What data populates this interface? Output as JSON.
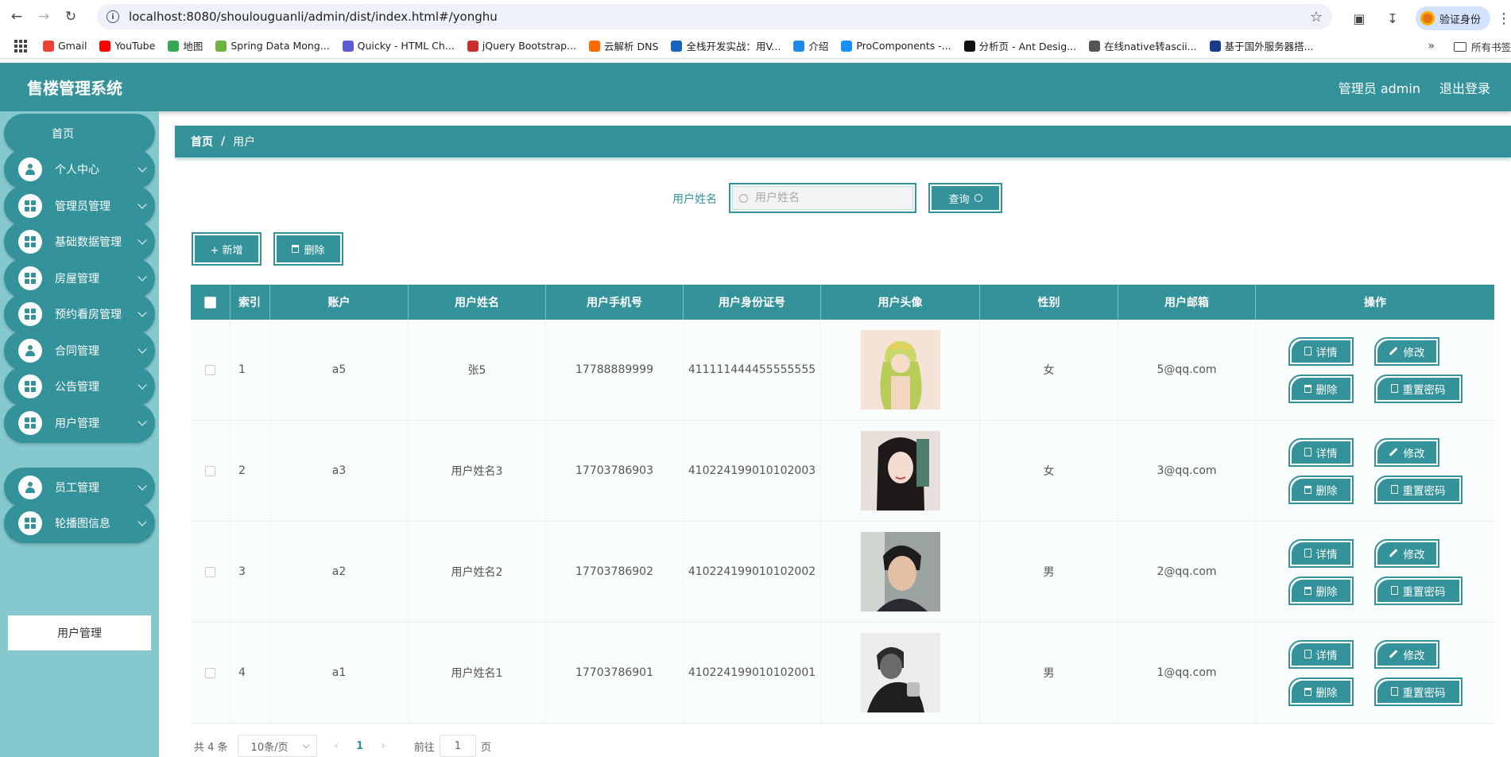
{
  "browser": {
    "url": "localhost:8080/shoulouguanli/admin/dist/index.html#/yonghu",
    "verify_label": "验证身份",
    "bookmarks": [
      {
        "label": "Gmail",
        "color": "#ea4335"
      },
      {
        "label": "YouTube",
        "color": "#ff0000"
      },
      {
        "label": "地图",
        "color": "#34a853"
      },
      {
        "label": "Spring Data Mong...",
        "color": "#6db33f"
      },
      {
        "label": "Quicky - HTML Ch...",
        "color": "#5b5bd6"
      },
      {
        "label": "jQuery Bootstrap...",
        "color": "#c9302c"
      },
      {
        "label": "云解析 DNS",
        "color": "#ff6a00"
      },
      {
        "label": "全栈开发实战：用V...",
        "color": "#1565c0"
      },
      {
        "label": "介绍",
        "color": "#1e88e5"
      },
      {
        "label": "ProComponents -...",
        "color": "#1890ff"
      },
      {
        "label": "分析页 - Ant Desig...",
        "color": "#111111"
      },
      {
        "label": "在线native转ascii...",
        "color": "#555555"
      },
      {
        "label": "基于国外服务器搭...",
        "color": "#1a3a8a"
      }
    ],
    "all_bookmarks": "所有书签"
  },
  "header": {
    "title": "售楼管理系统",
    "user": "管理员 admin",
    "logout": "退出登录"
  },
  "sidebar": {
    "home": "首页",
    "items": [
      {
        "label": "个人中心",
        "icon": "person-icon"
      },
      {
        "label": "管理员管理",
        "icon": "grid-icon"
      },
      {
        "label": "基础数据管理",
        "icon": "wallet-icon"
      },
      {
        "label": "房屋管理",
        "icon": "grid-icon"
      },
      {
        "label": "预约看房管理",
        "icon": "chat-icon"
      },
      {
        "label": "合同管理",
        "icon": "person-icon"
      },
      {
        "label": "公告管理",
        "icon": "grid-icon"
      },
      {
        "label": "用户管理",
        "icon": "grid-icon"
      },
      {
        "label": "员工管理",
        "icon": "person-icon"
      },
      {
        "label": "轮播图信息",
        "icon": "grid-icon"
      }
    ],
    "submenu": "用户管理"
  },
  "breadcrumb": {
    "home": "首页",
    "sep": "/",
    "current": "用户"
  },
  "search": {
    "label": "用户姓名",
    "placeholder": "用户姓名",
    "button": "查询"
  },
  "actions": {
    "add": "+ 新增",
    "delete": "删除"
  },
  "table": {
    "columns": [
      "",
      "索引",
      "账户",
      "用户姓名",
      "用户手机号",
      "用户身份证号",
      "用户头像",
      "性别",
      "用户邮箱",
      "操作"
    ],
    "rows": [
      {
        "index": "1",
        "account": "a5",
        "name": "张5",
        "phone": "17788889999",
        "id_no": "411111444455555555",
        "gender": "女",
        "email": "5@qq.com"
      },
      {
        "index": "2",
        "account": "a3",
        "name": "用户姓名3",
        "phone": "17703786903",
        "id_no": "410224199010102003",
        "gender": "女",
        "email": "3@qq.com"
      },
      {
        "index": "3",
        "account": "a2",
        "name": "用户姓名2",
        "phone": "17703786902",
        "id_no": "410224199010102002",
        "gender": "男",
        "email": "2@qq.com"
      },
      {
        "index": "4",
        "account": "a1",
        "name": "用户姓名1",
        "phone": "17703786901",
        "id_no": "410224199010102001",
        "gender": "男",
        "email": "1@qq.com"
      }
    ],
    "ops": {
      "detail": "详情",
      "edit": "修改",
      "delete": "删除",
      "reset": "重置密码"
    }
  },
  "pager": {
    "total": "共 4 条",
    "size": "10条/页",
    "prev": "‹",
    "page": "1",
    "next": "›",
    "goto": "前往",
    "goto_value": "1",
    "page_suffix": "页"
  },
  "colors": {
    "accent": "#34929a",
    "sidebar_bg": "#85c8ce"
  }
}
